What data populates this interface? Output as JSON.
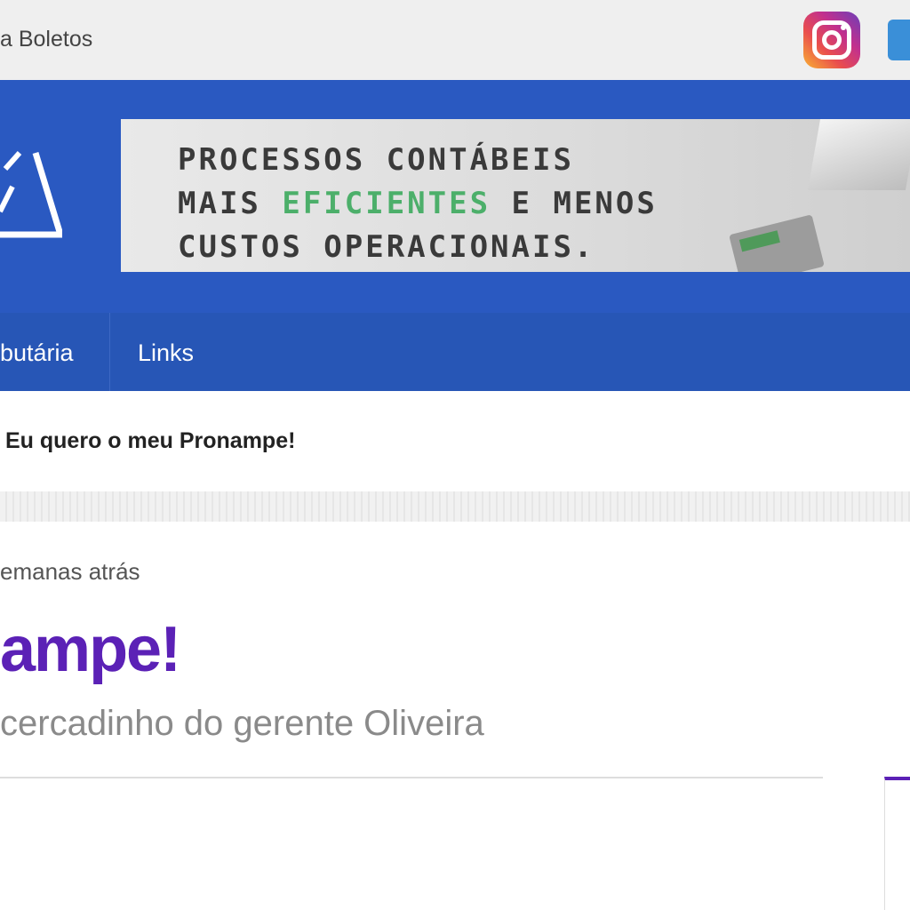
{
  "topbar": {
    "link_text": "a Boletos",
    "social_icons": [
      "instagram-icon",
      "twitter-icon"
    ]
  },
  "banner": {
    "line1": "PROCESSOS CONTÁBEIS",
    "line2_before": "MAIS ",
    "line2_highlight": "EFICIENTES",
    "line2_after": " E MENOS",
    "line3": "CUSTOS OPERACIONAIS.",
    "highlight_color": "#4caf6a"
  },
  "nav": {
    "items": [
      {
        "label": "butária"
      },
      {
        "label": "Links"
      }
    ]
  },
  "breadcrumb": "Eu quero o meu Pronampe!",
  "post": {
    "date": "emanas atrás",
    "title": "ampe!",
    "subtitle": "cercadinho do gerente Oliveira"
  },
  "colors": {
    "header_blue": "#2a59c1",
    "nav_blue": "#2756b6",
    "title_purple": "#5b21b6"
  }
}
